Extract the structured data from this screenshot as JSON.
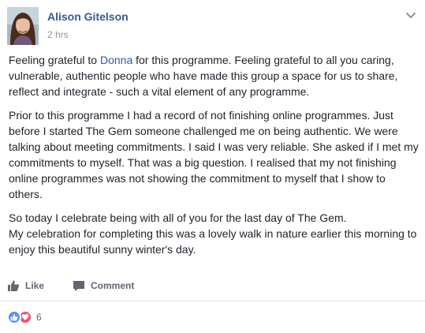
{
  "post": {
    "author": "Alison Gitelson",
    "timestamp": "2 hrs",
    "paragraphs": {
      "p1_before": "Feeling grateful to ",
      "p1_mention": "Donna",
      "p1_after": " for this programme. Feeling grateful to all you caring, vulnerable, authentic people who have made this group a space for us to share, reflect and integrate - such a vital element of any programme.",
      "p2": "Prior to this programme I had a record of not finishing online programmes. Just before I started The Gem someone challenged me on being authentic. We were talking about meeting commitments. I said I was very reliable. She asked if I met my commitments to myself. That was a big question. I realised that my not finishing online programmes was not showing the commitment to myself that I show to others.",
      "p3": "So today I celebrate being with all of you for the last day of The Gem.\nMy celebration for completing this was a lovely walk in nature earlier this morning to enjoy this beautiful sunny winter's day."
    }
  },
  "actions": {
    "like_label": "Like",
    "comment_label": "Comment"
  },
  "reactions": {
    "icons": [
      "like-icon",
      "love-icon"
    ],
    "count": "6"
  },
  "colors": {
    "link": "#365899",
    "text": "#1d2129",
    "muted": "#90949c",
    "action": "#606770",
    "like_reaction": "#5890ff",
    "love_reaction": "#f25268"
  }
}
